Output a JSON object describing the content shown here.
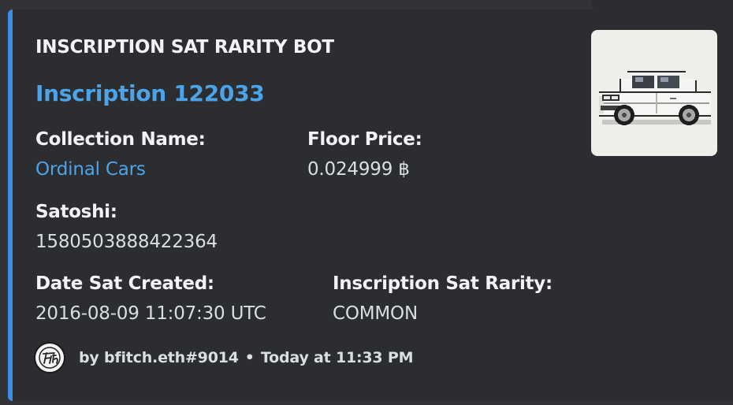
{
  "embed": {
    "accent_color": "#3b8ee8",
    "author": "INSCRIPTION SAT RARITY BOT",
    "title": "Inscription 122033",
    "thumbnail_icon": "car-pixel-art-icon",
    "fields": {
      "collection": {
        "name": "Collection Name:",
        "value": "Ordinal Cars"
      },
      "floor_price": {
        "name": "Floor Price:",
        "value": "0.024999 ฿"
      },
      "satoshi": {
        "name": "Satoshi:",
        "value": "1580503888422364"
      },
      "date_created": {
        "name": "Date Sat Created:",
        "value": "2016-08-09 11:07:30 UTC"
      },
      "rarity": {
        "name": "Inscription Sat Rarity:",
        "value": "COMMON"
      }
    },
    "footer": {
      "icon": "fitch-logo-icon",
      "text": "by bfitch.eth#9014",
      "separator": "•",
      "timestamp": "Today at 11:33 PM"
    }
  }
}
